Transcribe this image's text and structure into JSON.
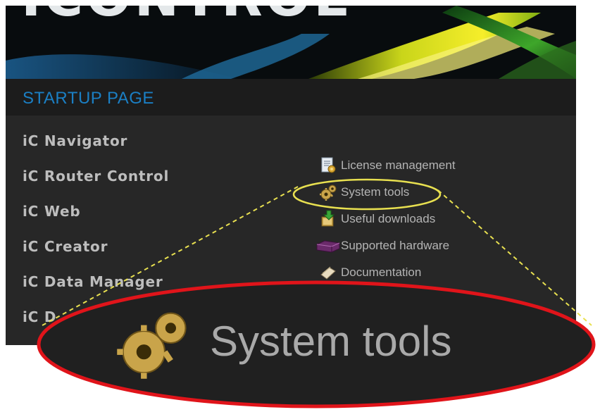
{
  "banner": {
    "title": "ICONTROL"
  },
  "header": {
    "page_title": "STARTUP PAGE"
  },
  "apps": [
    {
      "label": "iC Navigator"
    },
    {
      "label": "iC Router Control"
    },
    {
      "label": "iC Web"
    },
    {
      "label": "iC Creator"
    },
    {
      "label": "iC Data Manager"
    },
    {
      "label": "iC D"
    }
  ],
  "tools": [
    {
      "label": "License management",
      "icon": "license-document-icon"
    },
    {
      "label": "System tools",
      "icon": "gears-icon"
    },
    {
      "label": "Useful downloads",
      "icon": "downloads-icon"
    },
    {
      "label": "Supported hardware",
      "icon": "hardware-icon"
    },
    {
      "label": "Documentation",
      "icon": "documentation-icon"
    }
  ],
  "callout": {
    "label": "System tools",
    "icon": "gears-icon"
  },
  "colors": {
    "page_title": "#1b7fc4",
    "app_text": "#bdbdbd",
    "tool_text": "#b4b4b4",
    "highlight_ellipse": "#e8e050",
    "callout_ellipse": "#e0141a",
    "background": "#272727"
  }
}
